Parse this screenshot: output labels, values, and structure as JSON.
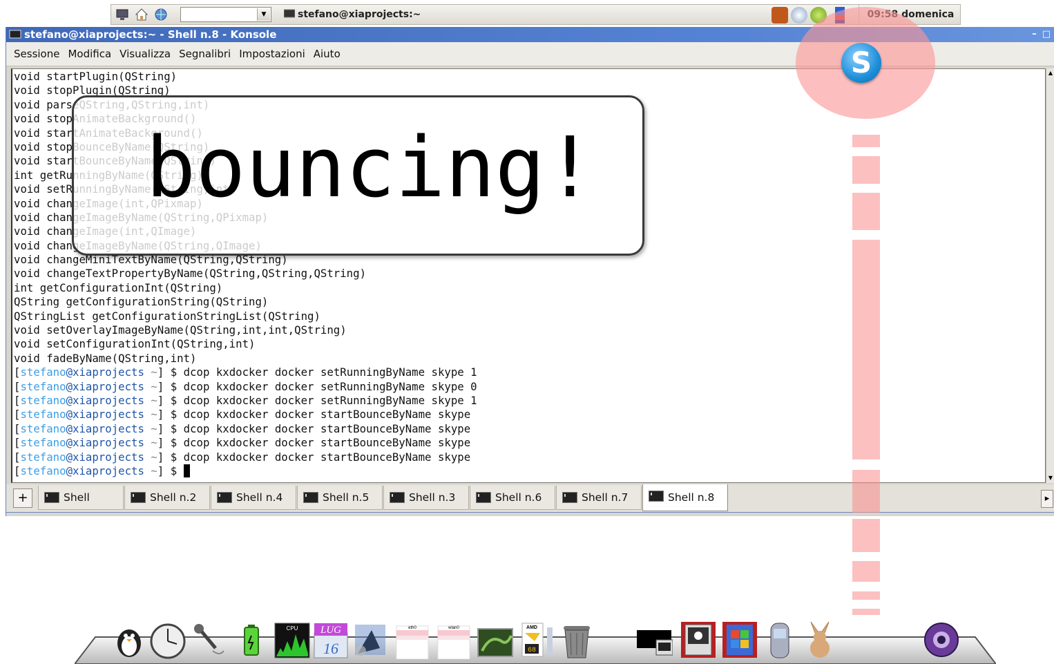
{
  "top_panel": {
    "task_title": "stefano@xiaprojects:~",
    "clock": "09:58 domenica"
  },
  "window": {
    "title": "stefano@xiaprojects:~ - Shell n.8 - Konsole",
    "menu": [
      "Sessione",
      "Modifica",
      "Visualizza",
      "Segnalibri",
      "Impostazioni",
      "Aiuto"
    ]
  },
  "terminal": {
    "output_lines": [
      "void startPlugin(QString)",
      "void stopPlugin(QString)",
      "void parseQString,QString,int)",
      "void stopAnimateBackground()",
      "void startAnimateBackground()",
      "void stopBounceByName(QString)",
      "void startBounceByName(QString)",
      "int getRunningByName(QString)",
      "void setRunningByName(QString,int)",
      "void changeImage(int,QPixmap)",
      "void changeImageByName(QString,QPixmap)",
      "void changeImage(int,QImage)",
      "void changeImageByName(QString,QImage)",
      "void changeMiniTextByName(QString,QString)",
      "void changeTextPropertyByName(QString,QString,QString)",
      "int getConfigurationInt(QString)",
      "QString getConfigurationString(QString)",
      "QStringList getConfigurationStringList(QString)",
      "void setOverlayImageByName(QString,int,int,QString)",
      "void setConfigurationInt(QString,int)",
      "void fadeByName(QString,int)"
    ],
    "prompt_user": "stefano",
    "prompt_host": "@xiaprojects",
    "prompt_dir": "~",
    "commands": [
      "dcop kxdocker docker setRunningByName skype 1",
      "dcop kxdocker docker setRunningByName skype 0",
      "dcop kxdocker docker setRunningByName skype 1",
      "dcop kxdocker docker startBounceByName skype",
      "dcop kxdocker docker startBounceByName skype",
      "dcop kxdocker docker startBounceByName skype",
      "dcop kxdocker docker startBounceByName skype"
    ]
  },
  "tabs": [
    {
      "label": "Shell",
      "active": false
    },
    {
      "label": "Shell n.2",
      "active": false
    },
    {
      "label": "Shell n.4",
      "active": false
    },
    {
      "label": "Shell n.5",
      "active": false
    },
    {
      "label": "Shell n.3",
      "active": false
    },
    {
      "label": "Shell n.6",
      "active": false
    },
    {
      "label": "Shell n.7",
      "active": false
    },
    {
      "label": "Shell n.8",
      "active": true
    }
  ],
  "popup": {
    "text": "bouncing!"
  },
  "skype": {
    "letter": "S",
    "accent": "#1e8ed8"
  },
  "dock": {
    "items": [
      {
        "name": "penguin-icon"
      },
      {
        "name": "clock-icon"
      },
      {
        "name": "microphone-icon"
      },
      {
        "name": "battery-icon"
      },
      {
        "name": "cpu-monitor-icon",
        "label": "CPU"
      },
      {
        "name": "calendar-icon",
        "month": "LUG",
        "day": "16"
      },
      {
        "name": "bird-icon"
      },
      {
        "name": "eth0-monitor-icon",
        "label": "eth0"
      },
      {
        "name": "wlan0-monitor-icon",
        "label": "wlan0"
      },
      {
        "name": "photo-icon"
      },
      {
        "name": "amd-sensor-icon",
        "label": "AMD",
        "temp": "68"
      },
      {
        "name": "trash-icon"
      },
      {
        "name": "terminal-icon"
      },
      {
        "name": "linux-pc-icon"
      },
      {
        "name": "windows-pc-icon"
      },
      {
        "name": "phone-icon"
      },
      {
        "name": "rabbit-icon"
      },
      {
        "name": "skype-dock-icon"
      },
      {
        "name": "media-player-icon"
      }
    ]
  }
}
